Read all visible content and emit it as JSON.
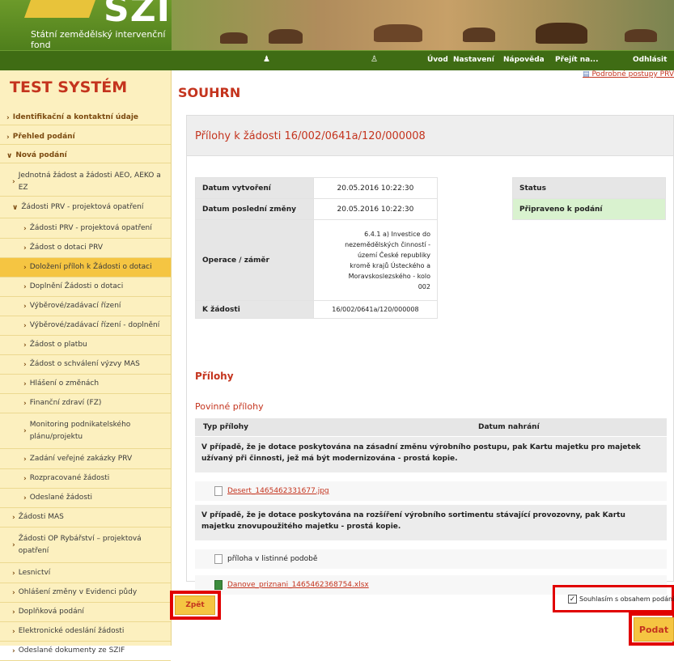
{
  "header": {
    "logo": "SZIF",
    "org_name": "Státní zemědělský intervenční fond",
    "nav": [
      "Úvod",
      "Nastavení",
      "Nápověda",
      "Přejít na...",
      "Odhlásit"
    ]
  },
  "sidebar": {
    "title": "TEST SYSTÉM",
    "items": [
      {
        "label": "Identifikační a kontaktní údaje",
        "level": 0
      },
      {
        "label": "Přehled podání",
        "level": 0
      },
      {
        "label": "Nová podání",
        "level": 0
      },
      {
        "label": "Jednotná žádost a žádosti AEO, AEKO a EZ",
        "level": 1
      },
      {
        "label": "Žádosti PRV - projektová opatření",
        "level": 1
      },
      {
        "label": "Žádosti PRV - projektová opatření",
        "level": 2
      },
      {
        "label": "Žádost o dotaci PRV",
        "level": 2
      },
      {
        "label": "Doložení příloh k Žádosti o dotaci",
        "level": 2,
        "active": true
      },
      {
        "label": "Doplnění Žádosti o dotaci",
        "level": 2
      },
      {
        "label": "Výběrové/zadávací řízení",
        "level": 2
      },
      {
        "label": "Výběrové/zadávací řízení - doplnění",
        "level": 2
      },
      {
        "label": "Žádost o platbu",
        "level": 2
      },
      {
        "label": "Žádost o schválení výzvy MAS",
        "level": 2
      },
      {
        "label": "Hlášení o změnách",
        "level": 2
      },
      {
        "label": "Finanční zdraví (FZ)",
        "level": 2
      },
      {
        "label": "Monitoring podnikatelského plánu/projektu",
        "level": 2
      },
      {
        "label": "Zadání veřejné zakázky PRV",
        "level": 2
      },
      {
        "label": "Rozpracované žádosti",
        "level": 2
      },
      {
        "label": "Odeslané žádosti",
        "level": 2
      },
      {
        "label": "Žádosti MAS",
        "level": 1
      },
      {
        "label": "Žádosti OP Rybářství – projektová opatření",
        "level": 1
      },
      {
        "label": "Lesnictví",
        "level": 1
      },
      {
        "label": "Ohlášení změny v Evidenci půdy",
        "level": 1
      },
      {
        "label": "Doplňková podání",
        "level": 1
      },
      {
        "label": "Elektronické odeslání žádosti",
        "level": 1
      },
      {
        "label": "Odeslané dokumenty ze SZIF",
        "level": 1
      }
    ]
  },
  "main": {
    "procedures_link": "Podrobné postupy PRV",
    "heading": "SOUHRN",
    "panel_title": "Přílohy k žádosti 16/002/0641a/120/000008",
    "info": {
      "created_label": "Datum vytvoření",
      "created_value": "20.05.2016 10:22:30",
      "modified_label": "Datum poslední změny",
      "modified_value": "20.05.2016 10:22:30",
      "operation_label": "Operace / záměr",
      "operation_value": "6.4.1 a) Investice do nezemědělských činností - území České republiky kromě krajů Ústeckého a Moravskoslezského - kolo 002",
      "request_label": "K žádosti",
      "request_value": "16/002/0641a/120/000008"
    },
    "status": {
      "label": "Status",
      "value": "Připraveno k podání"
    },
    "attachments_heading": "Přílohy",
    "mandatory_heading": "Povinné přílohy",
    "col_type": "Typ přílohy",
    "col_uploaded": "Datum nahrání",
    "attachments": [
      {
        "desc": "V případě, že je dotace poskytována na zásadní změnu výrobního postupu, pak Kartu majetku pro majetek užívaný při činnosti, jež má být modernizována - prostá kopie.",
        "files": [
          {
            "name": "Desert_1465462331677.jpg",
            "link": true,
            "icon": "jpg"
          }
        ]
      },
      {
        "desc": "V případě, že je dotace poskytována na rozšíření výrobního sortimentu stávající provozovny, pak Kartu majetku znovupoužitého majetku - prostá kopie.",
        "files": [
          {
            "name": "příloha v listinné podobě",
            "link": false,
            "icon": "doc"
          },
          {
            "name": "Danove_priznani_1465462368754.xlsx",
            "link": true,
            "icon": "xls"
          }
        ]
      }
    ],
    "back_button": "Zpět",
    "agree_label": "Souhlasím s obsahem podání",
    "submit_button": "Podat"
  }
}
